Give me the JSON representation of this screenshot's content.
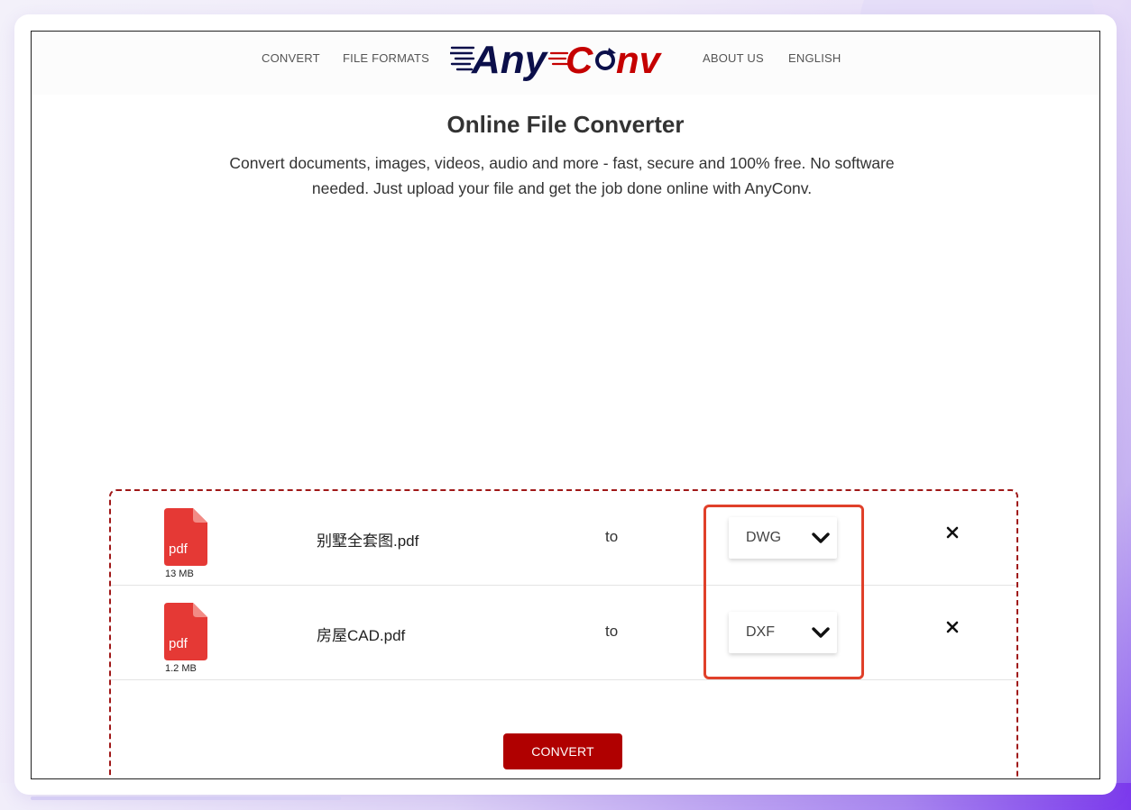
{
  "nav": {
    "items": [
      {
        "label": "CONVERT"
      },
      {
        "label": "FILE FORMATS"
      },
      {
        "label": "ABOUT US"
      },
      {
        "label": "ENGLISH"
      }
    ],
    "logo_text": "AnyConv",
    "logo_colors": {
      "primary": "#0b0f4a",
      "accent": "#c50000"
    }
  },
  "hero": {
    "title": "Online File Converter",
    "description": "Convert documents, images, videos, audio and more - fast, secure and 100% free. No software needed. Just upload your file and get the job done online with AnyConv."
  },
  "files": [
    {
      "icon": "pdf-file-icon",
      "type_label": "pdf",
      "size": "13 MB",
      "name": "别墅全套图.pdf",
      "to_label": "to",
      "target_format": "DWG"
    },
    {
      "icon": "pdf-file-icon",
      "type_label": "pdf",
      "size": "1.2 MB",
      "name": "房屋CAD.pdf",
      "to_label": "to",
      "target_format": "DXF"
    }
  ],
  "convert_button": "CONVERT",
  "colors": {
    "brand_red": "#b00000",
    "dashed_border": "#a01818",
    "highlight": "#e0402a",
    "pdf_icon": "#e53935"
  }
}
